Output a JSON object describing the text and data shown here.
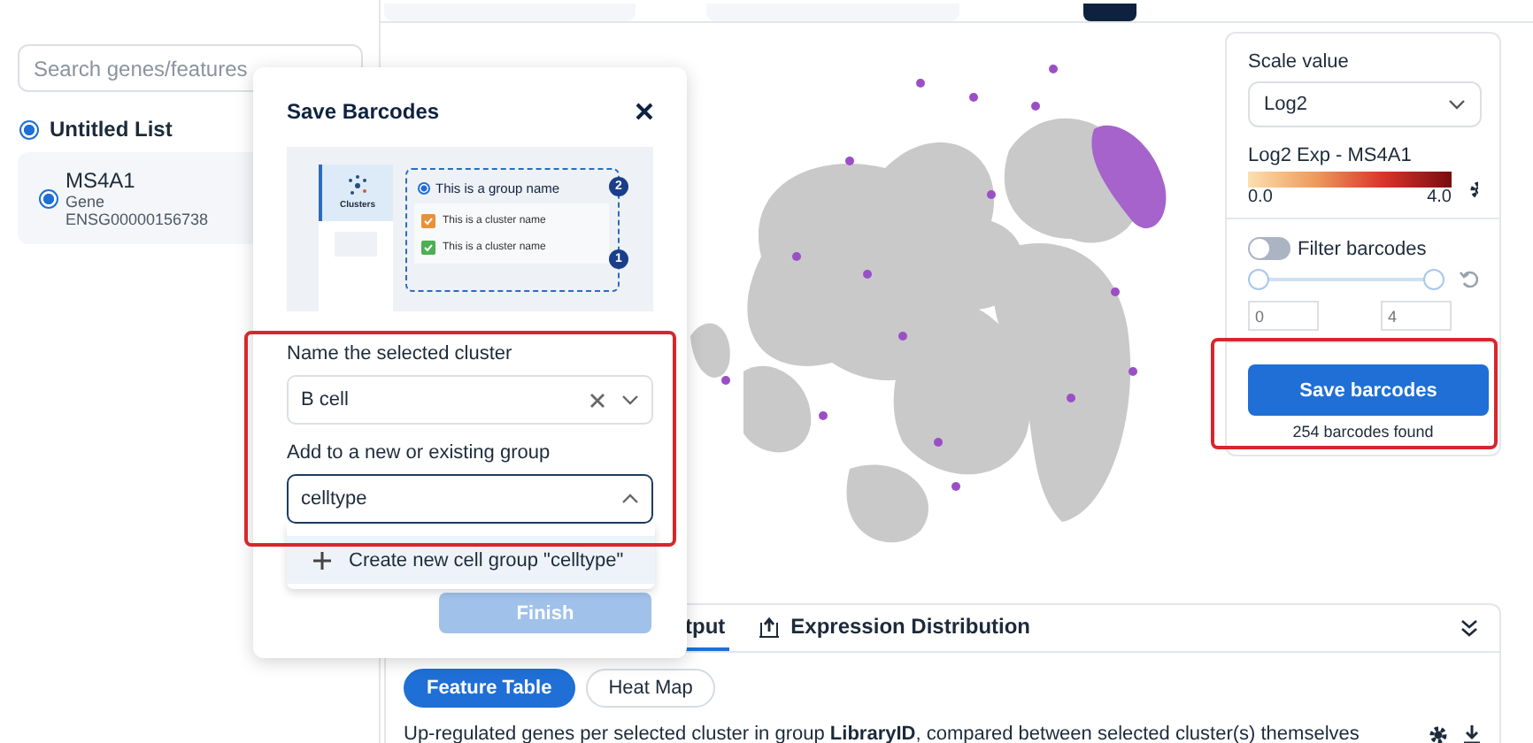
{
  "sidebar": {
    "search": {
      "placeholder": "Search genes/features"
    },
    "list": {
      "title": "Untitled List",
      "selected": true
    },
    "features": [
      {
        "name": "MS4A1",
        "type": "Gene",
        "id": "ENSG00000156738",
        "selected": true
      }
    ]
  },
  "settings": {
    "scale_label": "Scale value",
    "scale_value": "Log2",
    "legend_title": "Log2 Exp - MS4A1",
    "legend_min": "0.0",
    "legend_max": "4.0",
    "filter": {
      "label": "Filter barcodes",
      "on": false
    },
    "range": {
      "thumbs": [
        {
          "level": 0
        },
        {
          "level": 1
        }
      ],
      "min_placeholder": "0",
      "max_placeholder": "4"
    },
    "save_button": "Save barcodes",
    "found": "254 barcodes found"
  },
  "results": {
    "tabs": [
      {
        "label": "tput",
        "selected": true
      },
      {
        "label": "Expression Distribution",
        "selected": false
      }
    ],
    "views": [
      {
        "label": "Feature Table",
        "selected": true
      },
      {
        "label": "Heat Map",
        "selected": false
      }
    ],
    "description": "Up-regulated genes per selected cluster in group **LibraryID**, compared between selected cluster(s) themselves"
  },
  "modal": {
    "title": "Save Barcodes",
    "illustration": {
      "tab": "Clusters",
      "group": "This is a group name",
      "group_selected": true,
      "group_badge": "2",
      "clusters": [
        {
          "name": "This is a cluster name",
          "checked": true,
          "color": "#e8913a"
        },
        {
          "name": "This is a cluster name",
          "checked": true,
          "color": "#4caf50",
          "badge": "1"
        }
      ]
    },
    "cluster_field": {
      "label": "Name the selected cluster",
      "value": "B cell"
    },
    "group_field": {
      "label": "Add to a new or existing group",
      "value": "celltype",
      "expanded": true
    },
    "options": [
      "Create new cell group \"celltype\""
    ],
    "finish": {
      "label": "Finish",
      "disabled": true
    }
  }
}
